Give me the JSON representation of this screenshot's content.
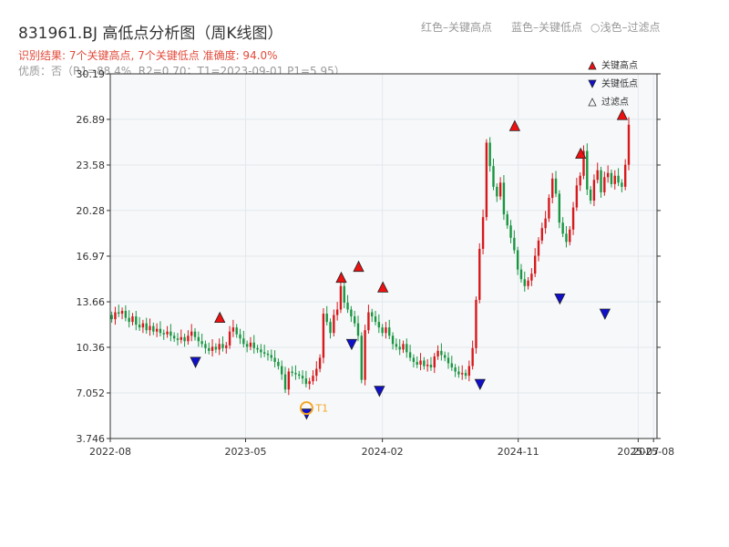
{
  "header": {
    "title": "831961.BJ 高低点分析图（周K线图）",
    "legend_red": "红色–关键高点",
    "legend_blue": "蓝色–关键低点",
    "legend_light": "浅色–过滤点",
    "legend_light_symbol": "○",
    "summary": "识别结果: 7个关键高点, 7个关键低点   准确度: 94.0%",
    "quality": "优质：否（R1=88.4%, R2=0.70；T1=2023-09-01 P1=5.95）"
  },
  "colors": {
    "up": "#d7191c",
    "down": "#1a9641",
    "high_marker": "#ee1111",
    "low_marker": "#1010cc",
    "t1": "#f5a623",
    "axis": "#333333",
    "grid": "#e4e7ec",
    "plot_bg": "#f6f8fa"
  },
  "chart_data": {
    "type": "candlestick",
    "title": "831961.BJ 高低点分析图（周K线图）",
    "y_ticks": [
      "3.746",
      "7.052",
      "10.36",
      "13.66",
      "16.97",
      "20.28",
      "23.58",
      "26.89",
      "30.19"
    ],
    "ylim": [
      3.746,
      30.19
    ],
    "x_ticks": [
      {
        "label": "2022-08",
        "date": "2022-08-01"
      },
      {
        "label": "2023-05",
        "date": "2023-05-01"
      },
      {
        "label": "2024-02",
        "date": "2024-02-01"
      },
      {
        "label": "2024-11",
        "date": "2024-11-01"
      },
      {
        "label": "2025-07",
        "date": "2025-07-01"
      },
      {
        "label": "2025-08",
        "date": "2025-08-01"
      }
    ],
    "xlim": [
      "2022-08-01",
      "2025-08-08"
    ],
    "grid": true,
    "legend": {
      "placement": "top-right",
      "entries": [
        {
          "label": "关键高点",
          "marker": "triangle-up",
          "color": "#ee1111"
        },
        {
          "label": "关键低点",
          "marker": "triangle-down",
          "color": "#1010cc"
        },
        {
          "label": "过滤点",
          "marker": "triangle-up-outline",
          "color": "#999999"
        }
      ]
    },
    "key_highs": [
      {
        "date": "2023-03-10",
        "value": 12.1
      },
      {
        "date": "2023-11-10",
        "value": 15.0
      },
      {
        "date": "2023-12-15",
        "value": 15.8
      },
      {
        "date": "2024-02-02",
        "value": 14.3
      },
      {
        "date": "2024-10-25",
        "value": 26.0
      },
      {
        "date": "2025-03-07",
        "value": 24.0
      },
      {
        "date": "2025-05-30",
        "value": 26.8
      }
    ],
    "key_lows": [
      {
        "date": "2023-01-20",
        "value": 9.7
      },
      {
        "date": "2023-12-01",
        "value": 11.0
      },
      {
        "date": "2024-01-26",
        "value": 7.6
      },
      {
        "date": "2024-08-16",
        "value": 8.1
      },
      {
        "date": "2025-01-24",
        "value": 14.3
      },
      {
        "date": "2025-04-25",
        "value": 13.2
      },
      {
        "date": "2023-09-01",
        "value": 5.95
      }
    ],
    "t1": {
      "label": "T1",
      "date": "2023-09-01",
      "value": 5.95
    },
    "weekly_close": [
      12.4,
      12.9,
      12.8,
      13.0,
      12.5,
      12.2,
      12.6,
      12.0,
      11.8,
      12.1,
      11.6,
      11.9,
      11.5,
      11.7,
      11.4,
      11.3,
      11.5,
      11.2,
      11.0,
      10.9,
      11.1,
      10.8,
      11.2,
      11.5,
      11.1,
      10.8,
      10.6,
      10.3,
      10.1,
      10.4,
      10.2,
      10.6,
      10.3,
      10.5,
      11.5,
      11.8,
      11.3,
      11.0,
      10.6,
      10.4,
      10.7,
      10.3,
      10.2,
      10.0,
      9.9,
      9.8,
      9.6,
      9.3,
      9.0,
      8.4,
      7.3,
      8.6,
      8.5,
      8.4,
      8.3,
      8.1,
      7.7,
      7.9,
      8.3,
      8.8,
      9.6,
      12.8,
      12.2,
      11.4,
      12.7,
      13.1,
      14.8,
      13.6,
      13.1,
      12.6,
      12.1,
      11.2,
      8.0,
      11.6,
      12.9,
      12.6,
      12.2,
      11.8,
      11.4,
      11.8,
      11.2,
      10.6,
      10.4,
      10.2,
      10.6,
      10.0,
      9.6,
      9.3,
      9.1,
      9.4,
      9.0,
      9.1,
      8.9,
      9.7,
      10.1,
      9.8,
      9.6,
      9.2,
      8.9,
      8.6,
      8.4,
      8.5,
      8.3,
      9.0,
      10.3,
      13.8,
      17.5,
      19.8,
      25.2,
      23.5,
      22.0,
      21.3,
      22.3,
      20.0,
      19.2,
      18.3,
      17.4,
      16.0,
      15.3,
      14.8,
      15.2,
      15.7,
      17.0,
      18.1,
      19.0,
      19.7,
      21.2,
      22.6,
      21.5,
      19.4,
      18.6,
      18.0,
      18.9,
      20.5,
      22.1,
      22.8,
      24.6,
      21.8,
      21.0,
      22.5,
      23.2,
      21.6,
      22.7,
      23.0,
      22.2,
      22.8,
      22.3,
      22.0,
      23.6,
      26.5
    ]
  }
}
